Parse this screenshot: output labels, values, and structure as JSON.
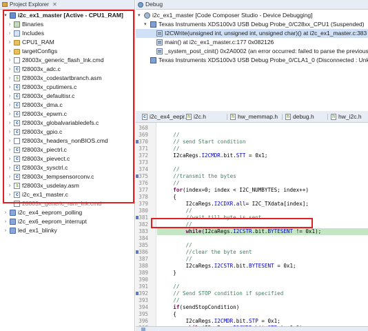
{
  "project_explorer": {
    "tab_label": "Project Explorer",
    "close_glyph": "✕",
    "items": [
      {
        "label": "i2c_ex1_master  [Active - CPU1_RAM]",
        "level": 0,
        "twisty": "▾",
        "icon": "project-icon",
        "bold": true
      },
      {
        "label": "Binaries",
        "level": 1,
        "twisty": "›",
        "icon": "binaries-icon"
      },
      {
        "label": "Includes",
        "level": 1,
        "twisty": "›",
        "icon": "includes-icon"
      },
      {
        "label": "CPU1_RAM",
        "level": 1,
        "twisty": "›",
        "icon": "folder-icon"
      },
      {
        "label": "targetConfigs",
        "level": 1,
        "twisty": "›",
        "icon": "folder-icon"
      },
      {
        "label": "28003x_generic_flash_lnk.cmd",
        "level": 1,
        "twisty": "›",
        "icon": "file-icon"
      },
      {
        "label": "f28003x_adc.c",
        "level": 1,
        "twisty": "›",
        "icon": "c-file-icon"
      },
      {
        "label": "f28003x_codestartbranch.asm",
        "level": 1,
        "twisty": "›",
        "icon": "asm-file-icon"
      },
      {
        "label": "f28003x_cputimers.c",
        "level": 1,
        "twisty": "›",
        "icon": "c-file-icon"
      },
      {
        "label": "f28003x_defaultisr.c",
        "level": 1,
        "twisty": "›",
        "icon": "c-file-icon"
      },
      {
        "label": "f28003x_dma.c",
        "level": 1,
        "twisty": "›",
        "icon": "c-file-icon"
      },
      {
        "label": "f28003x_epwm.c",
        "level": 1,
        "twisty": "›",
        "icon": "c-file-icon"
      },
      {
        "label": "f28003x_globalvariabledefs.c",
        "level": 1,
        "twisty": "›",
        "icon": "c-file-icon"
      },
      {
        "label": "f28003x_gpio.c",
        "level": 1,
        "twisty": "›",
        "icon": "c-file-icon"
      },
      {
        "label": "f28003x_headers_nonBIOS.cmd",
        "level": 1,
        "twisty": "›",
        "icon": "file-icon"
      },
      {
        "label": "f28003x_piectrl.c",
        "level": 1,
        "twisty": "›",
        "icon": "c-file-icon"
      },
      {
        "label": "f28003x_pievect.c",
        "level": 1,
        "twisty": "›",
        "icon": "c-file-icon"
      },
      {
        "label": "f28003x_sysctrl.c",
        "level": 1,
        "twisty": "›",
        "icon": "c-file-icon"
      },
      {
        "label": "f28003x_tempsensorconv.c",
        "level": 1,
        "twisty": "›",
        "icon": "c-file-icon"
      },
      {
        "label": "f28003x_usdelay.asm",
        "level": 1,
        "twisty": "›",
        "icon": "asm-file-icon"
      },
      {
        "label": "i2c_ex1_master.c",
        "level": 1,
        "twisty": "›",
        "icon": "c-file-icon"
      },
      {
        "label": "28003x_generic_ram_lnk.cmd",
        "level": 1,
        "twisty": "",
        "icon": "file-icon",
        "dim": true
      },
      {
        "label": "i2c_ex4_eeprom_polling",
        "level": 0,
        "twisty": "›",
        "icon": "project-closed-icon"
      },
      {
        "label": "i2c_ex6_eeprom_interrupt",
        "level": 0,
        "twisty": "›",
        "icon": "project-closed-icon"
      },
      {
        "label": "led_ex1_blinky",
        "level": 0,
        "twisty": "›",
        "icon": "project-closed-icon"
      }
    ]
  },
  "debug": {
    "tab_label": "Debug",
    "rows": [
      {
        "label": "i2c_ex1_master [Code Composer Studio - Device Debugging]",
        "level": 0,
        "twisty": "▾",
        "icon": "debug-session-icon"
      },
      {
        "label": "Texas Instruments XDS100v3 USB Debug Probe_0/C28xx_CPU1 (Suspended)",
        "level": 1,
        "twisty": "▾",
        "icon": "cpu-thread-icon"
      },
      {
        "label": "I2CWrite(unsigned int, unsigned int, unsigned char)() at i2c_ex1_master.c:383 0x08",
        "level": 2,
        "twisty": "",
        "icon": "stack-frame-icon",
        "selected": true
      },
      {
        "label": "main() at i2c_ex1_master.c:177 0x082126",
        "level": 2,
        "twisty": "",
        "icon": "stack-frame-icon"
      },
      {
        "label": "_system_post_cinit() 0x2A0002  (an error occurred: failed to parse the previous fra",
        "level": 2,
        "twisty": "",
        "icon": "stack-frame-icon"
      },
      {
        "label": "Texas Instruments XDS100v3 USB Debug Probe_0/CLA1_0 (Disconnected : Unknown)",
        "level": 1,
        "twisty": "",
        "icon": "cpu-thread-icon"
      }
    ]
  },
  "editor": {
    "tabs": [
      {
        "label": "i2c_ex4_eepr...",
        "icon": "c"
      },
      {
        "label": "i2c.h",
        "icon": "h"
      },
      {
        "label": "hw_memmap.h",
        "icon": "h"
      },
      {
        "label": "debug.h",
        "icon": "h"
      },
      {
        "label": "hw_i2c.h",
        "icon": "h"
      }
    ],
    "lines": [
      {
        "num": "368",
        "text": ""
      },
      {
        "num": "369",
        "text": "    //"
      },
      {
        "num": "370",
        "text": "    // send Start condition"
      },
      {
        "num": "371",
        "text": "    //"
      },
      {
        "num": "372",
        "text": "    I2caRegs.I2CMDR.bit.STT = 0x1;"
      },
      {
        "num": "373",
        "text": ""
      },
      {
        "num": "374",
        "text": "    //"
      },
      {
        "num": "375",
        "text": "    //transmit the bytes"
      },
      {
        "num": "376",
        "text": "    //"
      },
      {
        "num": "377",
        "text": "    for(index=0; index < I2C_NUMBYTES; index++)"
      },
      {
        "num": "378",
        "text": "    {"
      },
      {
        "num": "379",
        "text": "        I2caRegs.I2CDXR.all= I2C_TXdata[index];"
      },
      {
        "num": "380",
        "text": "        //"
      },
      {
        "num": "381",
        "text": "        //wait till byte is sent"
      },
      {
        "num": "382",
        "text": "        //"
      },
      {
        "num": "383",
        "text": "        while(I2caRegs.I2CSTR.bit.BYTESENT != 0x1);"
      },
      {
        "num": "384",
        "text": ""
      },
      {
        "num": "385",
        "text": "        //"
      },
      {
        "num": "386",
        "text": "        //clear the byte sent"
      },
      {
        "num": "387",
        "text": "        //"
      },
      {
        "num": "388",
        "text": "        I2caRegs.I2CSTR.bit.BYTESENT = 0x1;"
      },
      {
        "num": "389",
        "text": "    }"
      },
      {
        "num": "390",
        "text": ""
      },
      {
        "num": "391",
        "text": "    //"
      },
      {
        "num": "392",
        "text": "    // Send STOP condition if specified"
      },
      {
        "num": "393",
        "text": "    //"
      },
      {
        "num": "394",
        "text": "    if(sendStopCondition)"
      },
      {
        "num": "395",
        "text": "    {"
      },
      {
        "num": "396",
        "text": "        I2caRegs.I2CMDR.bit.STP = 0x1;"
      },
      {
        "num": "397",
        "text": "        while(I2caRegs.I2CMDR.bit.STP != 0x0);"
      },
      {
        "num": "398",
        "text": ""
      }
    ],
    "current_line": "383",
    "marked_lines": [
      "370",
      "375",
      "381",
      "386",
      "392"
    ]
  },
  "colors": {
    "annotation_red": "#e02020",
    "current_line_bg": "#c4e6c4",
    "comment": "#3f7f5f",
    "keyword": "#7f0055",
    "field": "#0000c0"
  }
}
